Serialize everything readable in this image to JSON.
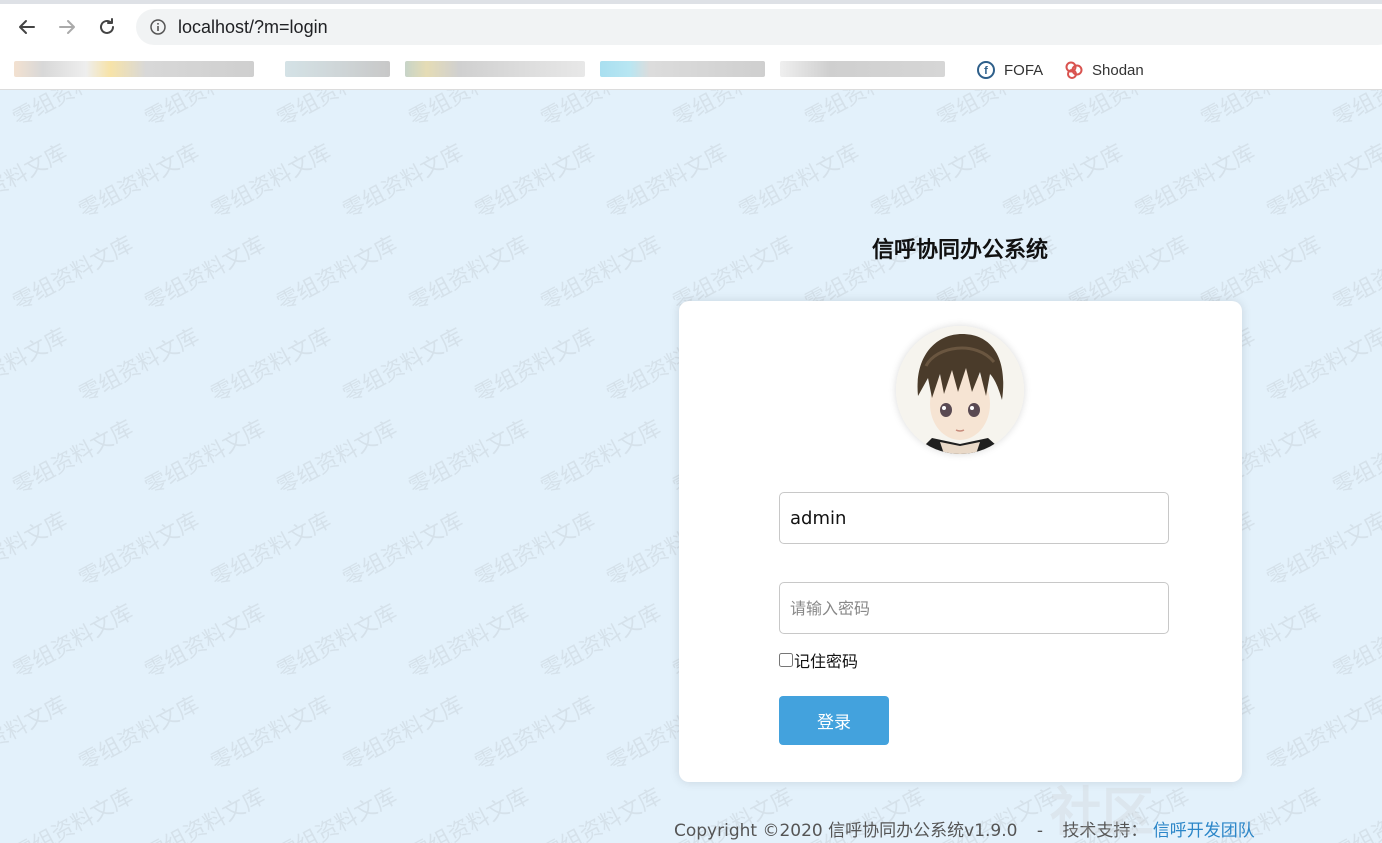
{
  "browser": {
    "url": "localhost/?m=login",
    "bookmarks": [
      {
        "label": "FOFA",
        "icon": "fofa-icon"
      },
      {
        "label": "Shodan",
        "icon": "shodan-icon"
      }
    ]
  },
  "login": {
    "title": "信呼协同办公系统",
    "username_value": "admin",
    "password_placeholder": "请输入密码",
    "remember_label": "记住密码",
    "submit_label": "登录"
  },
  "footer": {
    "copyright": "Copyright ©2020 信呼协同办公系统v1.9.0",
    "separator": "-",
    "support_label": "技术支持：",
    "support_link": "信呼开发团队"
  },
  "watermark": {
    "text": "零组资料文库",
    "corner_text": "社区"
  },
  "colors": {
    "page_bg": "#e3f1fb",
    "button": "#43a2dd",
    "link": "#2b86c8"
  }
}
